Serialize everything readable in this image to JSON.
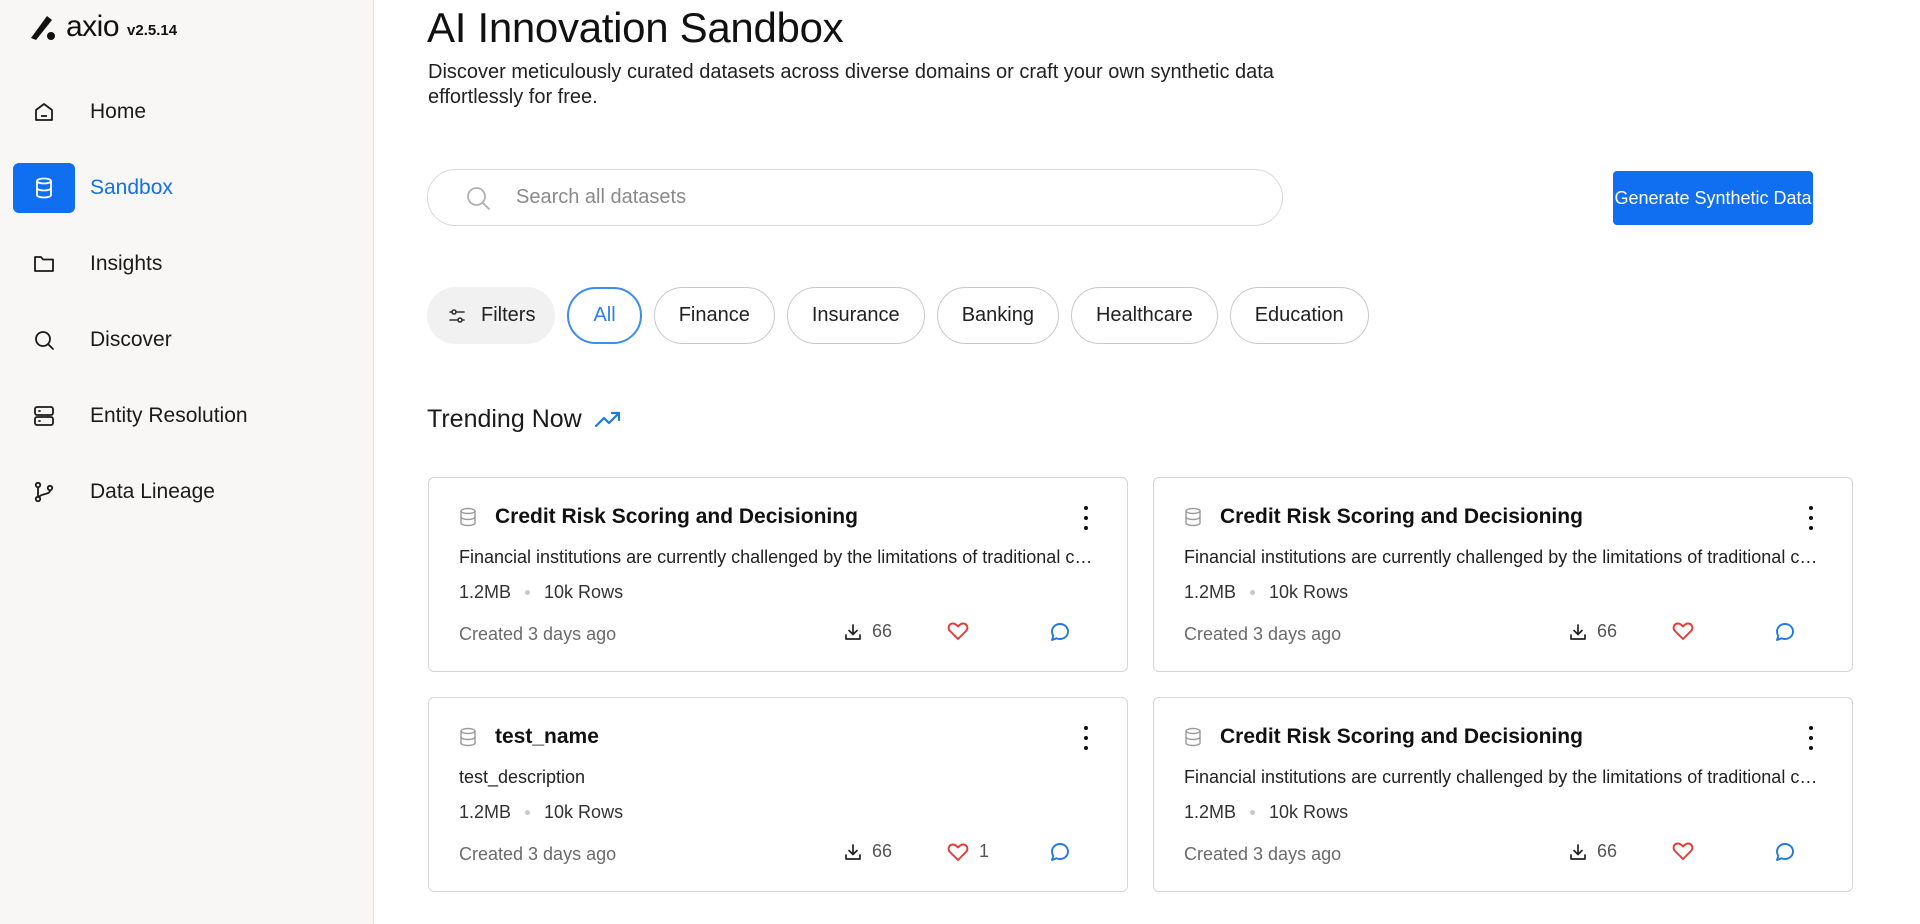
{
  "brand": {
    "name": "axio",
    "version": "v2.5.14"
  },
  "nav": [
    {
      "label": "Home",
      "icon": "home-icon",
      "active": false
    },
    {
      "label": "Sandbox",
      "icon": "database-icon",
      "active": true
    },
    {
      "label": "Insights",
      "icon": "folder-icon",
      "active": false
    },
    {
      "label": "Discover",
      "icon": "search-icon",
      "active": false
    },
    {
      "label": "Entity Resolution",
      "icon": "server-icon",
      "active": false
    },
    {
      "label": "Data Lineage",
      "icon": "git-branch-icon",
      "active": false
    }
  ],
  "page": {
    "title": "AI Innovation Sandbox",
    "subtitle": "Discover meticulously curated datasets across diverse domains or craft your own synthetic data effortlessly for free."
  },
  "search": {
    "placeholder": "Search all datasets"
  },
  "generate_button": "Generate Synthetic Data",
  "filters": {
    "button_label": "Filters",
    "chips": [
      "All",
      "Finance",
      "Insurance",
      "Banking",
      "Healthcare",
      "Education"
    ],
    "active": "All"
  },
  "trending": {
    "title": "Trending Now"
  },
  "cards": [
    {
      "title": "Credit Risk Scoring and Decisioning",
      "description": "Financial institutions are currently challenged by the limitations of traditional credit scoring models",
      "size": "1.2MB",
      "rows": "10k Rows",
      "created": "Created 3 days ago",
      "downloads": "66",
      "likes": ""
    },
    {
      "title": "Credit Risk Scoring and Decisioning",
      "description": "Financial institutions are currently challenged by the limitations of traditional credit scoring models",
      "size": "1.2MB",
      "rows": "10k Rows",
      "created": "Created 3 days ago",
      "downloads": "66",
      "likes": ""
    },
    {
      "title": "test_name",
      "description": "test_description",
      "size": "1.2MB",
      "rows": "10k Rows",
      "created": "Created 3 days ago",
      "downloads": "66",
      "likes": "1"
    },
    {
      "title": "Credit Risk Scoring and Decisioning",
      "description": "Financial institutions are currently challenged by the limitations of traditional credit scoring models",
      "size": "1.2MB",
      "rows": "10k Rows",
      "created": "Created 3 days ago",
      "downloads": "66",
      "likes": ""
    }
  ],
  "colors": {
    "accent": "#0f6ff0",
    "heart": "#e53935",
    "sidebar_bg": "#f8f7f5"
  }
}
